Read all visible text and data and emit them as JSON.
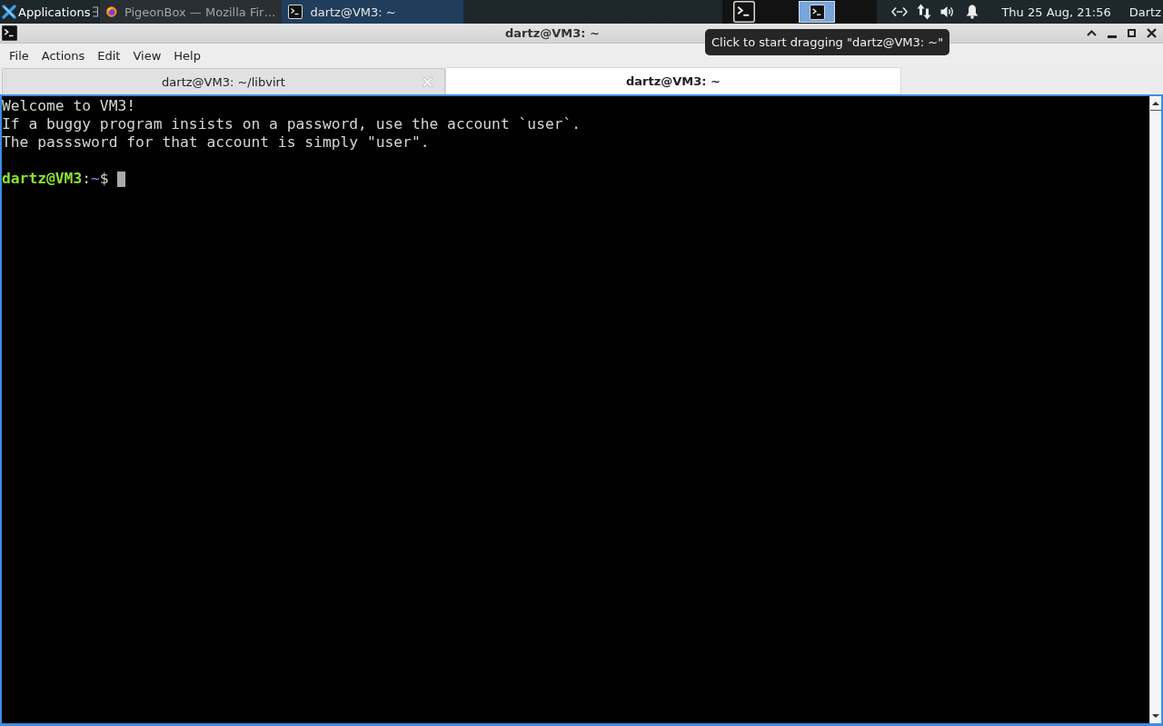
{
  "panel": {
    "apps_menu": "Applications",
    "tasks": [
      {
        "kind": "browser",
        "label": "PigeonBox — Mozilla Fir…",
        "selected": false
      },
      {
        "kind": "terminal",
        "label": "dartz@VM3: ~",
        "selected": true
      }
    ],
    "workspaces": [
      {
        "selected": false
      },
      {
        "selected": true
      }
    ],
    "clock": "Thu 25 Aug, 21:56",
    "user": "Dartz"
  },
  "window": {
    "title": "dartz@VM3: ~",
    "tooltip": "Click to start dragging \"dartz@VM3: ~\""
  },
  "menu": [
    "File",
    "Actions",
    "Edit",
    "View",
    "Help"
  ],
  "tabs": [
    {
      "label": "dartz@VM3: ~/libvirt",
      "selected": false,
      "close_button": true
    },
    {
      "label": "dartz@VM3: ~",
      "selected": true,
      "close_button": false
    }
  ],
  "terminal": {
    "output": [
      "Welcome to VM3!",
      "If a buggy program insists on a password, use the account `user`.",
      "The passsword for that account is simply \"user\"."
    ],
    "prompt": {
      "user_host": "dartz@VM3",
      "separator": ":",
      "path": "~",
      "symbol": "$"
    }
  }
}
